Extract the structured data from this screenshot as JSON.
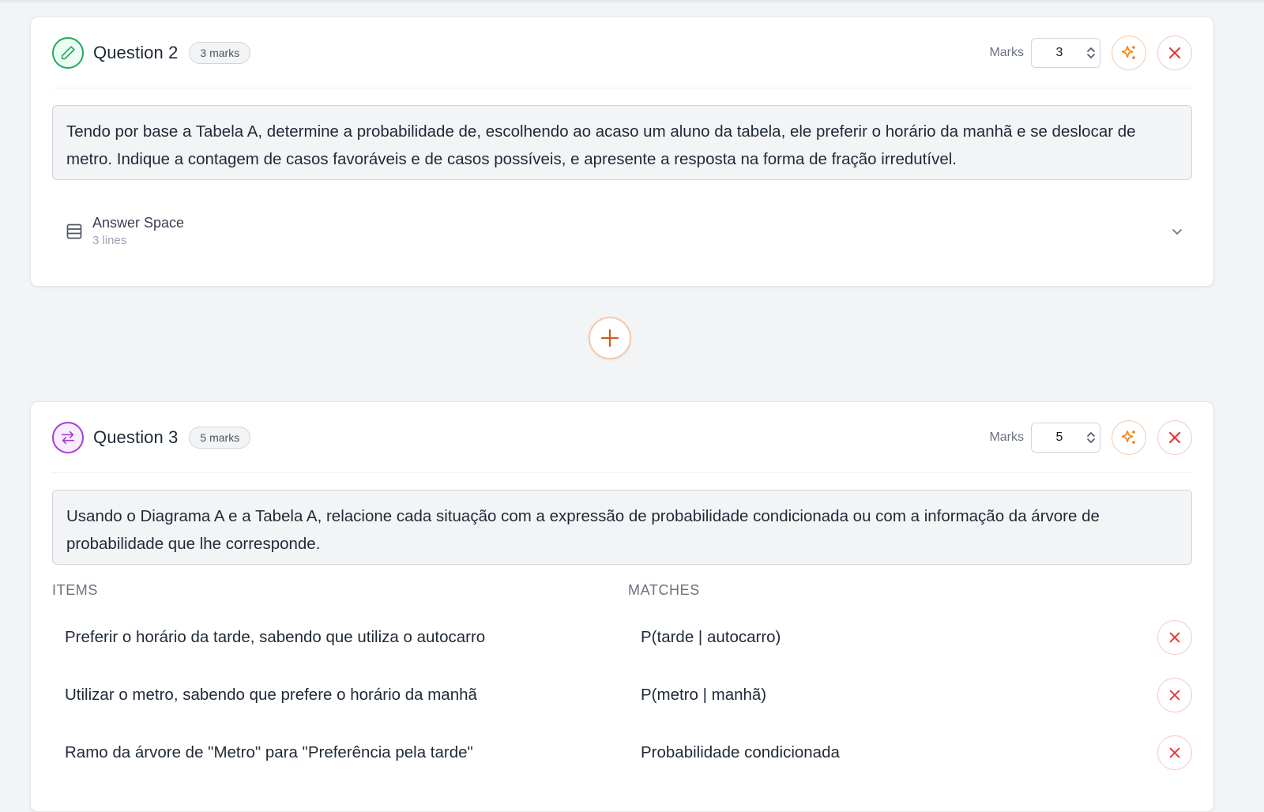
{
  "questions": [
    {
      "title": "Question 2",
      "marks_badge": "3 marks",
      "marks_label": "Marks",
      "marks_value": "3",
      "type_icon": "pencil-icon",
      "prompt": "Tendo por base a Tabela A, determine a probabilidade de, escolhendo ao acaso um aluno da tabela, ele preferir o horário da manhã e se deslocar de metro. Indique a contagem de casos favoráveis e de casos possíveis, e apresente a resposta na forma de fração irredutível.",
      "answer_space": {
        "title": "Answer Space",
        "subtitle": "3 lines"
      }
    },
    {
      "title": "Question 3",
      "marks_badge": "5 marks",
      "marks_label": "Marks",
      "marks_value": "5",
      "type_icon": "arrows-swap-icon",
      "prompt": "Usando o Diagrama A e a Tabela A, relacione cada situação com a expressão de probabilidade condicionada ou com a informação da árvore de probabilidade que lhe corresponde.",
      "items_header": "ITEMS",
      "matches_header": "MATCHES",
      "pairs": [
        {
          "item": "Preferir o horário da tarde, sabendo que utiliza o autocarro",
          "match": "P(tarde | autocarro)"
        },
        {
          "item": "Utilizar o metro, sabendo que prefere o horário da manhã",
          "match": "P(metro | manhã)"
        },
        {
          "item": "Ramo da árvore de \"Metro\" para \"Preferência pela tarde\"",
          "match": "Probabilidade condicionada"
        }
      ]
    }
  ],
  "colors": {
    "ai_accent": "#f08a24",
    "delete": "#e23b3b",
    "add": "#d9541e",
    "q2_icon": "#22a85a",
    "q3_icon": "#a33fd9"
  }
}
